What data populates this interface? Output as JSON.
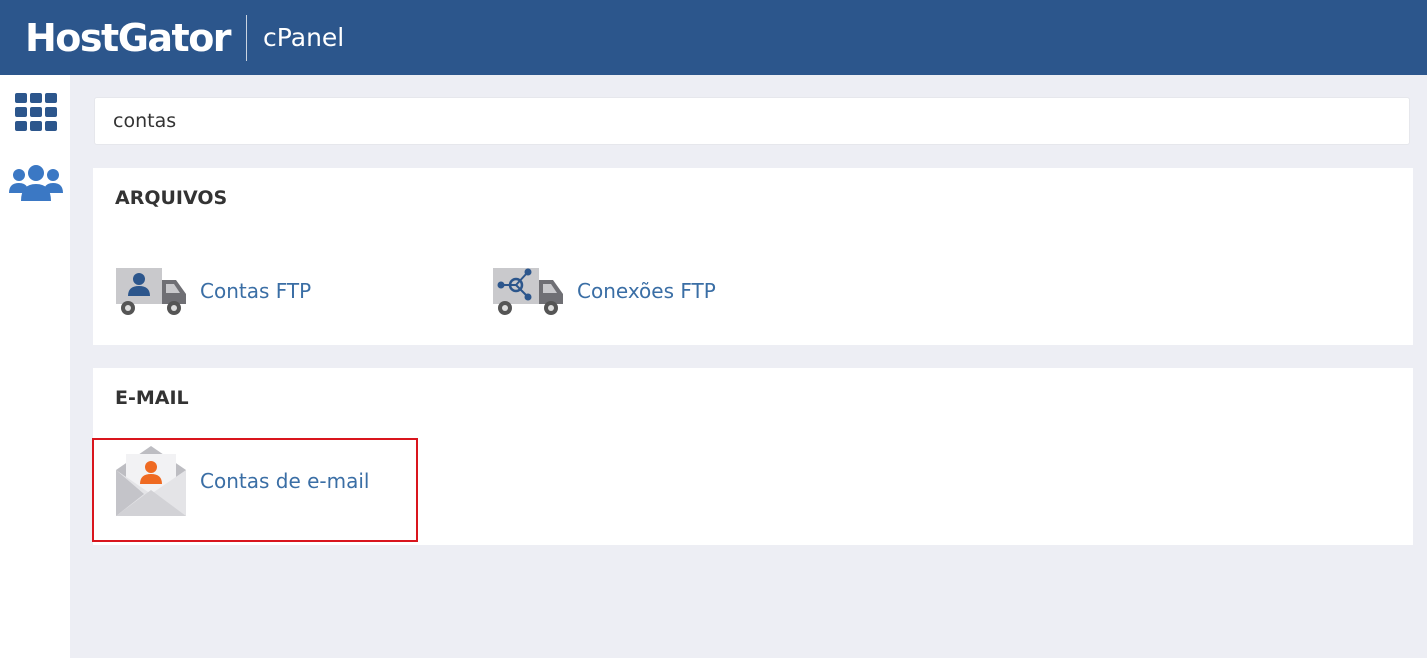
{
  "header": {
    "brand": "HostGator",
    "product": "cPanel",
    "background_color": "#2c568c"
  },
  "sidebar": {
    "items": [
      {
        "icon": "grid-icon",
        "name": "apps"
      },
      {
        "icon": "users-icon",
        "name": "users"
      }
    ]
  },
  "search": {
    "value": "contas",
    "placeholder": ""
  },
  "sections": [
    {
      "title": "ARQUIVOS",
      "items": [
        {
          "label": "Contas FTP",
          "icon": "ftp-accounts-truck-icon"
        },
        {
          "label": "Conexões FTP",
          "icon": "ftp-connections-truck-icon"
        }
      ]
    },
    {
      "title": "E-MAIL",
      "items": [
        {
          "label": "Contas de e-mail",
          "icon": "email-accounts-envelope-icon"
        }
      ]
    }
  ],
  "colors": {
    "link": "#3a6ea5",
    "highlight_border": "#d9151d",
    "page_background": "#edeef4"
  }
}
